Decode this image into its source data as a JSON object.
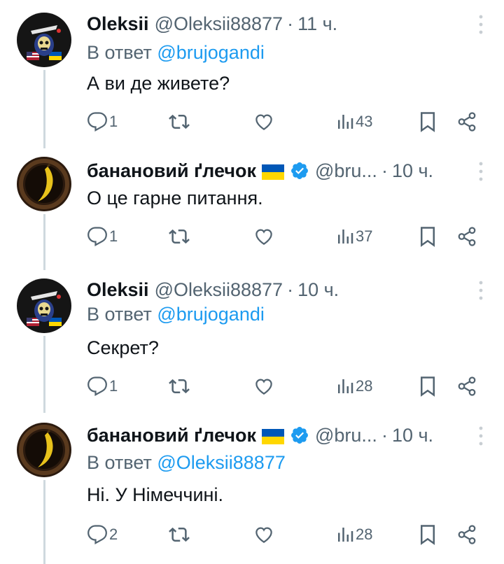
{
  "tweets": [
    {
      "name": "Oleksii",
      "handle": "@Oleksii88877",
      "time": "11 ч.",
      "reply_prefix": "В ответ",
      "reply_to": "@brujogandi",
      "text": "А ви де живете?",
      "replies": "1",
      "views": "43",
      "avatar": "metallica-skull-avatar",
      "flag": false,
      "verified": false
    },
    {
      "name": "банановий ґлечок",
      "handle": "@bru...",
      "time": "10 ч.",
      "text": "О це гарне питання.",
      "replies": "1",
      "views": "37",
      "avatar": "banana-avatar",
      "flag": true,
      "verified": true
    },
    {
      "name": "Oleksii",
      "handle": "@Oleksii88877",
      "time": "10 ч.",
      "reply_prefix": "В ответ",
      "reply_to": "@brujogandi",
      "text": "Секрет?",
      "replies": "1",
      "views": "28",
      "avatar": "metallica-skull-avatar",
      "flag": false,
      "verified": false
    },
    {
      "name": "банановий ґлечок",
      "handle": "@bru...",
      "time": "10 ч.",
      "reply_prefix": "В ответ",
      "reply_to": "@Oleksii88877",
      "text": "Ні. У Німеччині.",
      "replies": "2",
      "views": "28",
      "avatar": "banana-avatar",
      "flag": true,
      "verified": true
    }
  ],
  "colors": {
    "accent": "#1d9bf0",
    "muted": "#536471",
    "text": "#0f1419",
    "line": "#cfd9de"
  }
}
